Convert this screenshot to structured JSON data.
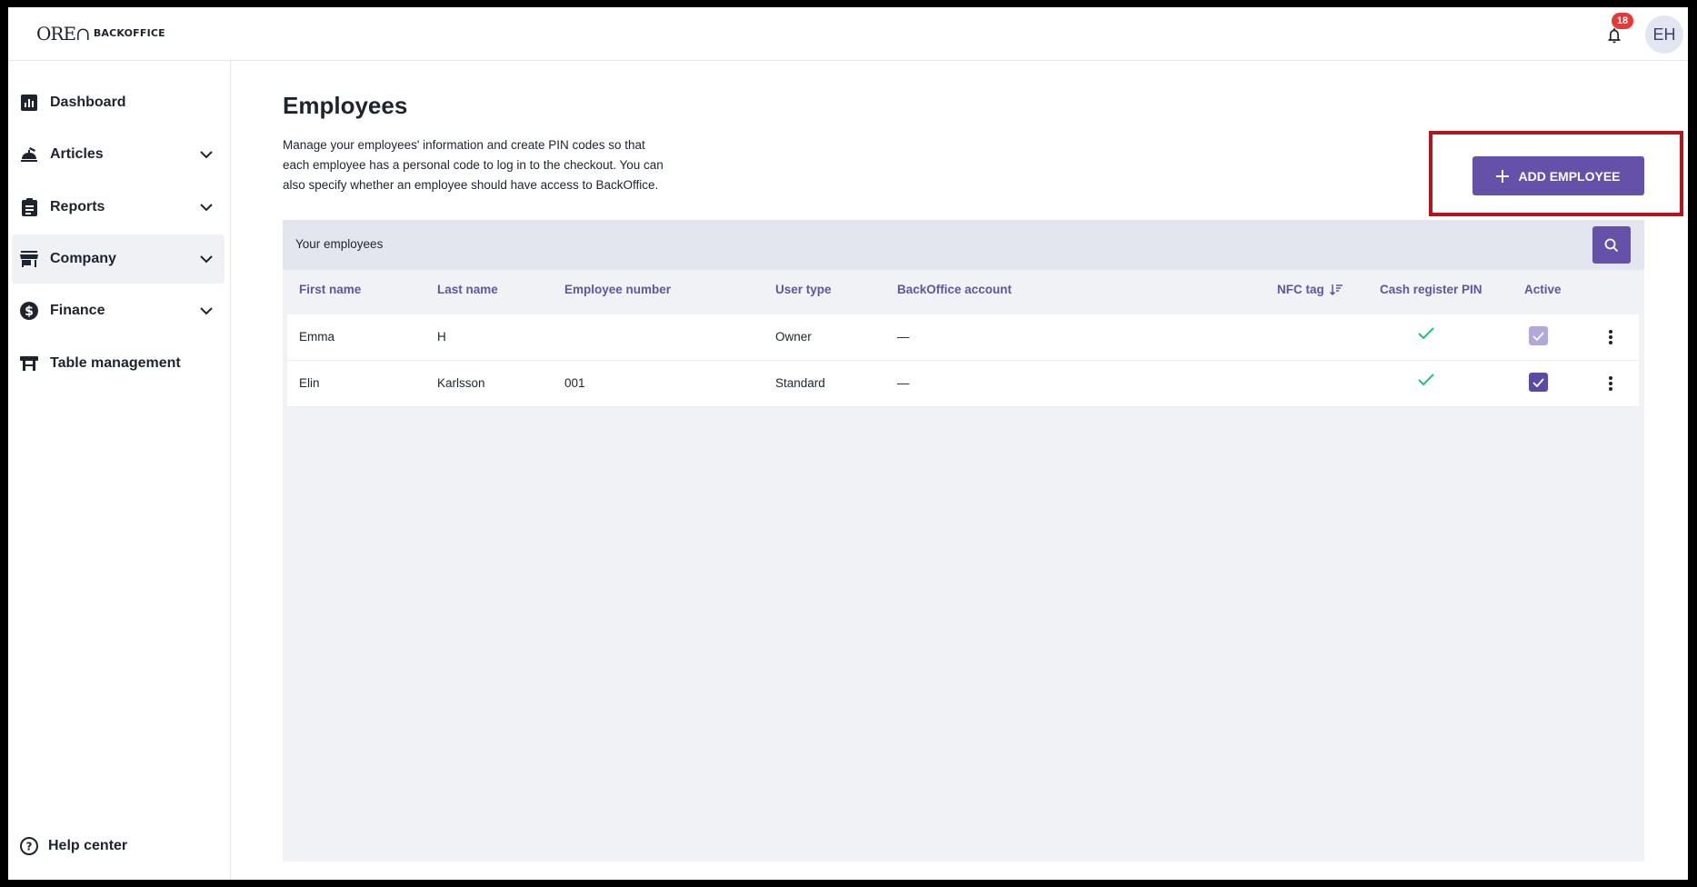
{
  "header": {
    "logo_mark": "ORE∩",
    "logo_text": "BACKOFFICE",
    "notification_count": "18",
    "avatar_initials": "EH"
  },
  "sidebar": {
    "items": [
      {
        "label": "Dashboard",
        "icon": "bar-chart-icon",
        "has_chevron": false,
        "active": false
      },
      {
        "label": "Articles",
        "icon": "articles-icon",
        "has_chevron": true,
        "active": false
      },
      {
        "label": "Reports",
        "icon": "clipboard-icon",
        "has_chevron": true,
        "active": false
      },
      {
        "label": "Company",
        "icon": "store-icon",
        "has_chevron": true,
        "active": true
      },
      {
        "label": "Finance",
        "icon": "dollar-icon",
        "has_chevron": true,
        "active": false
      },
      {
        "label": "Table management",
        "icon": "table-icon",
        "has_chevron": false,
        "active": false
      }
    ],
    "help_label": "Help center"
  },
  "main": {
    "title": "Employees",
    "description": "Manage your employees' information and create PIN codes so that each employee has a personal code to log in to the checkout. You can also specify whether an employee should have access to BackOffice.",
    "add_button_label": "ADD EMPLOYEE",
    "card_title": "Your employees",
    "columns": [
      "First name",
      "Last name",
      "Employee number",
      "User type",
      "BackOffice account",
      "NFC tag",
      "Cash register PIN",
      "Active"
    ],
    "rows": [
      {
        "first_name": "Emma",
        "last_name": "H",
        "employee_number": "",
        "user_type": "Owner",
        "backoffice_account": "—",
        "nfc_tag": "",
        "pin": true,
        "active": true,
        "active_style": "disabled"
      },
      {
        "first_name": "Elin",
        "last_name": "Karlsson",
        "employee_number": "001",
        "user_type": "Standard",
        "backoffice_account": "—",
        "nfc_tag": "",
        "pin": true,
        "active": true,
        "active_style": "enabled"
      }
    ]
  },
  "colors": {
    "accent": "#6552a8",
    "header_text": "#5f55a0",
    "check_green": "#22c07a",
    "badge_red": "#e53935",
    "highlight_red": "#b5141c"
  }
}
